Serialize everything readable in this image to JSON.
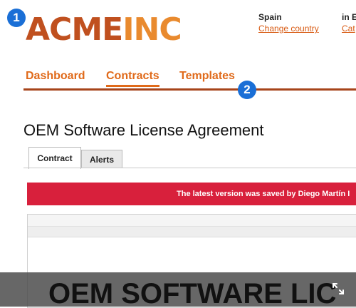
{
  "callouts": [
    "1",
    "2"
  ],
  "logo": {
    "part1": "ACME",
    "part2": "INC"
  },
  "locale": {
    "country": "Spain",
    "change_link": "Change country",
    "lang_prefix": "in E",
    "cat_link": "Cat"
  },
  "nav": {
    "items": [
      {
        "label": "Dashboard"
      },
      {
        "label": "Contracts"
      },
      {
        "label": "Templates"
      }
    ],
    "active": "Contracts"
  },
  "page": {
    "title": "OEM Software License Agreement"
  },
  "tabs": [
    {
      "label": "Contract"
    },
    {
      "label": "Alerts"
    }
  ],
  "alert": {
    "text": "The latest version was saved by Diego Martín I"
  },
  "preview": {
    "text": "OEM SOFTWARE LIC"
  },
  "icons": {
    "expand": "expand-icon"
  },
  "colors": {
    "accent": "#e06a1a",
    "nav_rule": "#a6441a",
    "alert": "#d8203c",
    "badge": "#1a6fd6"
  }
}
